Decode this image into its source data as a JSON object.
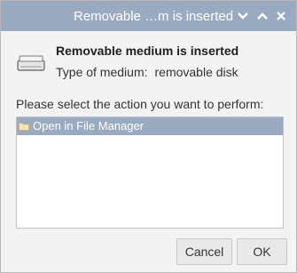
{
  "window": {
    "title": "Removable …m is inserted",
    "buttons": {
      "minimize": "chevron-down-icon",
      "maximize": "chevron-up-icon",
      "close": "close-icon"
    }
  },
  "dialog": {
    "heading": "Removable medium is inserted",
    "medium_label": "Type of medium:",
    "medium_value": "removable disk",
    "prompt": "Please select the action you want to perform:"
  },
  "actions": [
    {
      "label": "Open in File Manager",
      "icon": "folder-icon",
      "selected": true
    }
  ],
  "buttons": {
    "cancel": "Cancel",
    "ok": "OK"
  },
  "colors": {
    "accent": "#9aaac0",
    "background": "#f3f3f3"
  }
}
